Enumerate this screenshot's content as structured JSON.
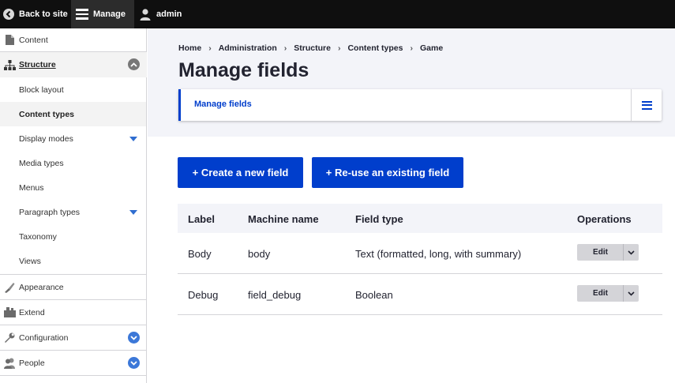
{
  "toolbar": {
    "back_label": "Back to site",
    "manage_label": "Manage",
    "user_label": "admin"
  },
  "sidebar": {
    "items": [
      {
        "label": "Content",
        "icon": "document-icon"
      },
      {
        "label": "Structure",
        "icon": "sitemap-icon",
        "expanded": true
      },
      {
        "label": "Appearance",
        "icon": "brush-icon"
      },
      {
        "label": "Extend",
        "icon": "puzzle-icon"
      },
      {
        "label": "Configuration",
        "icon": "wrench-icon"
      },
      {
        "label": "People",
        "icon": "people-icon"
      }
    ],
    "structure_children": [
      {
        "label": "Block layout"
      },
      {
        "label": "Content types",
        "active": true
      },
      {
        "label": "Display modes",
        "has_children": true
      },
      {
        "label": "Media types"
      },
      {
        "label": "Menus"
      },
      {
        "label": "Paragraph types",
        "has_children": true
      },
      {
        "label": "Taxonomy"
      },
      {
        "label": "Views"
      }
    ]
  },
  "breadcrumb": [
    "Home",
    "Administration",
    "Structure",
    "Content types",
    "Game"
  ],
  "page_title": "Manage fields",
  "tabs": {
    "primary": "Manage fields"
  },
  "actions": {
    "create": "+ Create a new field",
    "reuse": "+ Re-use an existing field"
  },
  "table": {
    "headers": [
      "Label",
      "Machine name",
      "Field type",
      "Operations"
    ],
    "rows": [
      {
        "label": "Body",
        "machine_name": "body",
        "field_type": "Text (formatted, long, with summary)",
        "operation": "Edit"
      },
      {
        "label": "Debug",
        "machine_name": "field_debug",
        "field_type": "Boolean",
        "operation": "Edit"
      }
    ]
  },
  "colors": {
    "primary": "#003ecc",
    "toolbar_bg": "#0f0f0f",
    "header_bg": "#f3f4f9"
  }
}
